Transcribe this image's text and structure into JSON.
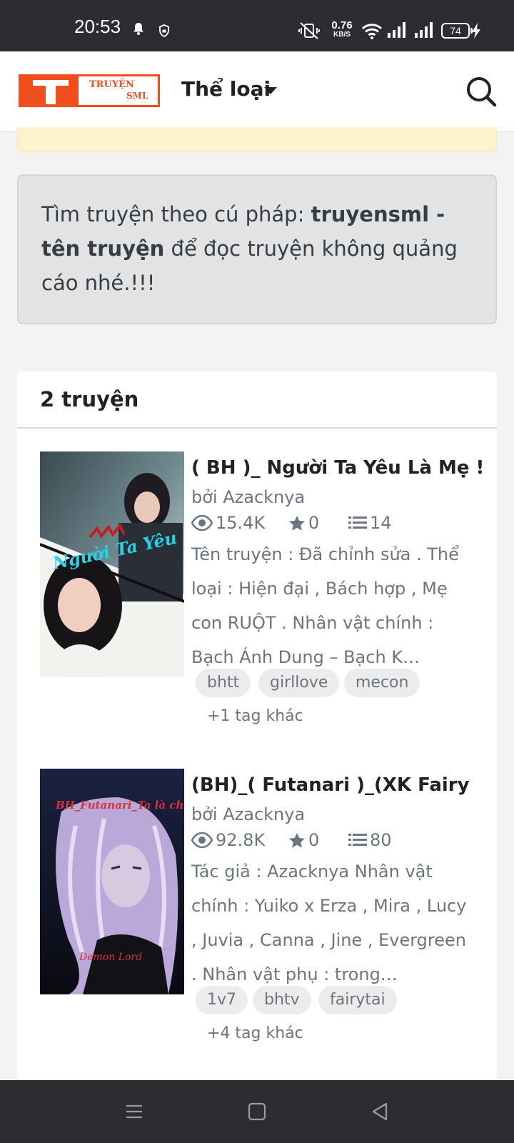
{
  "status_bar": {
    "time": "20:53",
    "speed_value": "0.76",
    "speed_unit": "KB/S",
    "battery": "74"
  },
  "header": {
    "logo_line1": "TRUYỆN",
    "logo_line2": "SML",
    "genre_label": "Thể loại",
    "search_icon": "search-icon"
  },
  "notice": {
    "prefix": "Tìm truyện theo cú pháp: ",
    "syntax": "truyensml - tên truyện",
    "suffix": " để đọc truyện không quảng cáo nhé.!!!"
  },
  "results": {
    "count_label": "2 truyện",
    "stories": [
      {
        "title": "( BH )_ Người Ta Yêu Là Mẹ !",
        "author": "bởi Azacknya",
        "views": "15.4K",
        "stars": "0",
        "chapters": "14",
        "description": "Tên truyện : Đã chỉnh sửa . Thể loại : Hiện đại , Bách hợp , Mẹ con RUỘT . Nhân vật chính : Bạch Ánh Dung – Bạch K…",
        "cover_text": "Người Ta Yêu",
        "tags": [
          "bhtt",
          "girllove",
          "mecon"
        ],
        "more_tags": "+1 tag khác"
      },
      {
        "title": "(BH)_( Futanari )_(XK Fairy",
        "author": "bởi Azacknya",
        "views": "92.8K",
        "stars": "0",
        "chapters": "80",
        "description": "Tác giả : Azacknya Nhân vật chính : Yuiko x Erza , Mira , Lucy , Juvia , Canna , Jine , Evergreen . Nhân vật phụ : trong…",
        "cover_text": "BH_Futanari_Ta là chúa quỷ !",
        "cover_signature": "Demon Lord",
        "tags": [
          "1v7",
          "bhtv",
          "fairytai"
        ],
        "more_tags": "+4 tag khác"
      }
    ]
  },
  "colors": {
    "brand": "#ee4f1d",
    "statusbar": "#2b2d31",
    "muted": "#6c757d"
  }
}
